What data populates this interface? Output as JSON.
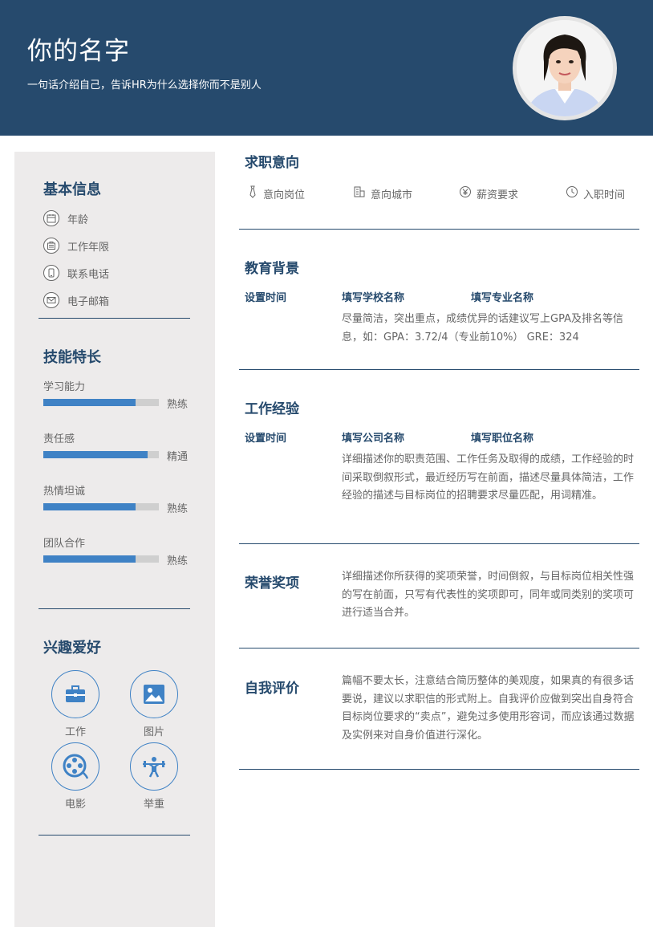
{
  "header": {
    "name": "你的名字",
    "tagline": "一句话介绍自己，告诉HR为什么选择你而不是别人"
  },
  "sidebar": {
    "basic_info": {
      "title": "基本信息",
      "items": [
        {
          "icon": "calendar-icon",
          "label": "年龄"
        },
        {
          "icon": "briefcase-list-icon",
          "label": "工作年限"
        },
        {
          "icon": "phone-icon",
          "label": "联系电话"
        },
        {
          "icon": "mail-icon",
          "label": "电子邮箱"
        }
      ]
    },
    "skills": {
      "title": "技能特长",
      "items": [
        {
          "name": "学习能力",
          "level": "熟练",
          "fill": 0.8
        },
        {
          "name": "责任感",
          "level": "精通",
          "fill": 0.9
        },
        {
          "name": "热情坦诚",
          "level": "熟练",
          "fill": 0.8
        },
        {
          "name": "团队合作",
          "level": "熟练",
          "fill": 0.8
        }
      ]
    },
    "hobbies": {
      "title": "兴趣爱好",
      "items": [
        {
          "icon": "briefcase-icon",
          "label": "工作"
        },
        {
          "icon": "picture-icon",
          "label": "图片"
        },
        {
          "icon": "film-reel-icon",
          "label": "电影"
        },
        {
          "icon": "weightlifting-icon",
          "label": "举重"
        }
      ]
    }
  },
  "job_intent": {
    "title": "求职意向",
    "items": [
      {
        "icon": "tie-icon",
        "label": "意向岗位"
      },
      {
        "icon": "building-icon",
        "label": "意向城市"
      },
      {
        "icon": "yen-icon",
        "label": "薪资要求"
      },
      {
        "icon": "clock-icon",
        "label": "入职时间"
      }
    ]
  },
  "education": {
    "title": "教育背景",
    "time": "设置时间",
    "school": "填写学校名称",
    "major": "填写专业名称",
    "desc": "尽量简洁，突出重点，成绩优异的话建议写上GPA及排名等信息，如：GPA：3.72/4（专业前10%） GRE：324"
  },
  "work": {
    "title": "工作经验",
    "time": "设置时间",
    "company": "填写公司名称",
    "position": "填写职位名称",
    "desc": "详细描述你的职责范围、工作任务及取得的成绩，工作经验的时间采取倒叙形式，最近经历写在前面，描述尽量具体简洁，工作经验的描述与目标岗位的招聘要求尽量匹配，用词精准。"
  },
  "honors": {
    "title": "荣誉奖项",
    "desc": "详细描述你所获得的奖项荣誉，时间倒叙，与目标岗位相关性强的写在前面，只写有代表性的奖项即可，同年或同类别的奖项可进行适当合并。"
  },
  "self_eval": {
    "title": "自我评价",
    "desc": "篇幅不要太长，注意结合简历整体的美观度，如果真的有很多话要说，建议以求职信的形式附上。自我评价应做到突出自身符合目标岗位要求的“卖点”，避免过多使用形容词，而应该通过数据及实例来对自身价值进行深化。"
  },
  "colors": {
    "primary": "#264a6d",
    "accent": "#3f82c5",
    "sidebar_bg": "#edebeb"
  }
}
